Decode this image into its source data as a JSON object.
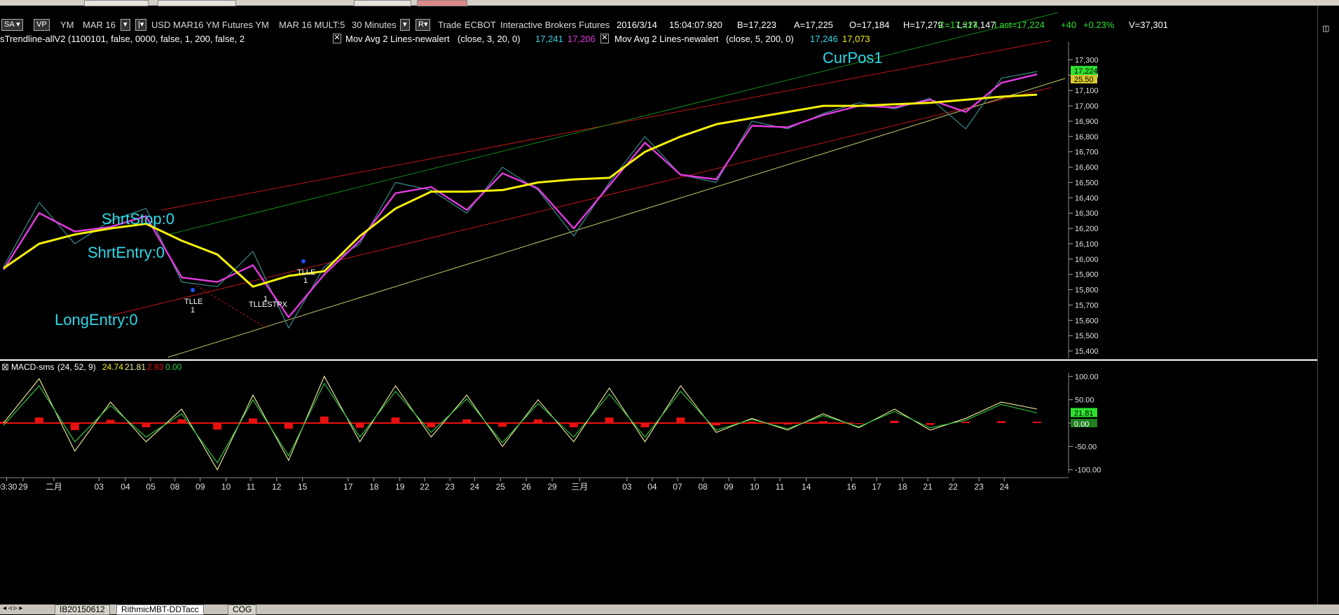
{
  "toolbar": {
    "sa_label": "SA",
    "vp_label": "VP",
    "symbol": "YM",
    "contract": "MAR 16",
    "description": "USD MAR16 YM Futures YM",
    "multiplier": "MAR 16 MULT:5",
    "interval": "30 Minutes",
    "r_label": "R",
    "trade_label": "Trade",
    "exchange": "ECBOT",
    "broker": "Interactive Brokers",
    "asset_class": "Futures",
    "datetime": "2016/3/14",
    "time": "15:04:07.920",
    "bid": "B=17,223",
    "ask": "A=17,225",
    "open": "O=17,184",
    "high": "H=17,279",
    "low": "L=17,147",
    "close": "C=17,224",
    "last": "Last=17,224",
    "change": "+40",
    "change_pct": "+0.23%",
    "volume": "V=37,301"
  },
  "studies": {
    "trendline": "sTrendline-allV2 (1100101, false, 0000, false, 1, 200, false, 2",
    "ma1_name": "Mov Avg 2 Lines-newalert",
    "ma1_params": "(close, 3, 20, 0)",
    "ma1_v1": "17,241",
    "ma1_v2": "17,206",
    "ma2_name": "Mov Avg 2 Lines-newalert",
    "ma2_params": "(close, 5, 200, 0)",
    "ma2_v1": "17,246",
    "ma2_v2": "17,073"
  },
  "colors": {
    "price": "#3a8a8a",
    "fast_ma": "#e23be0",
    "slow_ma": "#f5f00a",
    "macd_line": "#f5f0a0",
    "signal_line": "#30d040",
    "histogram": "#e81010",
    "channel_red": "#c01818",
    "channel_green": "#1a8a1a",
    "channel_yellow": "#c8c870",
    "cyan_text": "#2fd8e8",
    "axis_text": "#e0e0e0"
  },
  "chart_data": [
    {
      "type": "line",
      "title": "",
      "x_labels": [
        "03:30",
        "29",
        "二月",
        "03",
        "04",
        "05",
        "08",
        "09",
        "10",
        "11",
        "12",
        "15",
        "17",
        "18",
        "19",
        "22",
        "23",
        "24",
        "25",
        "26",
        "29",
        "三月",
        "03",
        "04",
        "07",
        "08",
        "09",
        "10",
        "11",
        "14",
        "16",
        "17",
        "18",
        "21",
        "22",
        "23",
        "24"
      ],
      "y_ticks": [
        15400,
        15500,
        15600,
        15700,
        15800,
        15900,
        16000,
        16100,
        16200,
        16300,
        16400,
        16500,
        16600,
        16700,
        16800,
        16900,
        17000,
        17100,
        17200,
        17300
      ],
      "y_tick_labels": [
        "15,400",
        "15,500",
        "15,600",
        "15,700",
        "15,800",
        "15,900",
        "16,000",
        "16,100",
        "16,200",
        "16,300",
        "16,400",
        "16,500",
        "16,600",
        "16,700",
        "16,800",
        "16,900",
        "17,000",
        "17,100",
        "17,200",
        "17,300"
      ],
      "ylim": [
        15350,
        17380
      ],
      "series": [
        {
          "name": "Price",
          "x": [
            0,
            1,
            2,
            3,
            4,
            5,
            6,
            7,
            8,
            9,
            10,
            11,
            12,
            13,
            14,
            15,
            16,
            17,
            18,
            19,
            20,
            21,
            22,
            23,
            24,
            25,
            26,
            27,
            28,
            29
          ],
          "values": [
            15950,
            16370,
            16100,
            16250,
            16330,
            15850,
            15820,
            16050,
            15550,
            15950,
            16100,
            16500,
            16450,
            16300,
            16600,
            16450,
            16150,
            16500,
            16800,
            16550,
            16500,
            16900,
            16850,
            16950,
            17020,
            16980,
            17050,
            16850,
            17180,
            17224
          ]
        },
        {
          "name": "Fast MA",
          "x": [
            0,
            1,
            2,
            3,
            4,
            5,
            6,
            7,
            8,
            9,
            10,
            11,
            12,
            13,
            14,
            15,
            16,
            17,
            18,
            19,
            20,
            21,
            22,
            23,
            24,
            25,
            26,
            27,
            28,
            29
          ],
          "values": [
            15930,
            16300,
            16180,
            16210,
            16280,
            15880,
            15850,
            15960,
            15620,
            15900,
            16120,
            16430,
            16470,
            16320,
            16560,
            16460,
            16200,
            16480,
            16760,
            16550,
            16520,
            16870,
            16860,
            16940,
            17000,
            16990,
            17040,
            16960,
            17150,
            17206
          ]
        },
        {
          "name": "Slow MA",
          "x": [
            0,
            1,
            2,
            3,
            4,
            5,
            6,
            7,
            8,
            9,
            10,
            11,
            12,
            13,
            14,
            15,
            16,
            17,
            18,
            19,
            20,
            21,
            22,
            23,
            24,
            25,
            26,
            27,
            28,
            29
          ],
          "values": [
            15940,
            16100,
            16160,
            16200,
            16230,
            16120,
            16030,
            15820,
            15890,
            15920,
            16150,
            16330,
            16440,
            16440,
            16450,
            16500,
            16520,
            16530,
            16700,
            16800,
            16880,
            16920,
            16960,
            17000,
            17000,
            17010,
            17020,
            17040,
            17060,
            17073
          ]
        }
      ],
      "annotations": [
        "ShrtStop:0",
        "ShrtEntry:0",
        "LongEntry:0",
        "CurPos1",
        "TLLE",
        "1",
        "TLLE",
        "1",
        "TLLESTPX",
        "1",
        "TLLE",
        "1"
      ],
      "last_value_tags": [
        "17,224",
        "25.50"
      ],
      "grid": false
    },
    {
      "type": "line",
      "title": "MACD-sms",
      "params": "(24, 52, 9)",
      "macd_value": "24.74",
      "signal_value": "21.81",
      "hist_value": "2.93",
      "zero_value": "0.00",
      "y_ticks": [
        100,
        50,
        0,
        -50,
        -100
      ],
      "y_tick_labels": [
        "100.00",
        "50.00",
        "",
        "-50.00",
        "-100.00"
      ],
      "ylim": [
        -108,
        108
      ],
      "last_value_tags": [
        "21.81",
        "0.00"
      ],
      "series": [
        {
          "name": "MACD",
          "x": [
            0,
            1,
            2,
            3,
            4,
            5,
            6,
            7,
            8,
            9,
            10,
            11,
            12,
            13,
            14,
            15,
            16,
            17,
            18,
            19,
            20,
            21,
            22,
            23,
            24,
            25,
            26,
            27,
            28,
            29
          ],
          "values": [
            0,
            95,
            -60,
            45,
            -40,
            30,
            -100,
            60,
            -80,
            100,
            -40,
            80,
            -30,
            60,
            -50,
            50,
            -40,
            75,
            -40,
            80,
            -20,
            10,
            -15,
            20,
            -10,
            30,
            -15,
            10,
            45,
            30
          ]
        },
        {
          "name": "Signal",
          "x": [
            0,
            1,
            2,
            3,
            4,
            5,
            6,
            7,
            8,
            9,
            10,
            11,
            12,
            13,
            14,
            15,
            16,
            17,
            18,
            19,
            20,
            21,
            22,
            23,
            24,
            25,
            26,
            27,
            28,
            29
          ],
          "values": [
            -5,
            80,
            -40,
            38,
            -30,
            20,
            -85,
            50,
            -70,
            85,
            -30,
            68,
            -20,
            52,
            -42,
            42,
            -30,
            62,
            -30,
            68,
            -15,
            8,
            -12,
            16,
            -8,
            25,
            -10,
            6,
            40,
            21.81
          ]
        },
        {
          "name": "Histogram",
          "x": [
            0,
            1,
            2,
            3,
            4,
            5,
            6,
            7,
            8,
            9,
            10,
            11,
            12,
            13,
            14,
            15,
            16,
            17,
            18,
            19,
            20,
            21,
            22,
            23,
            24,
            25,
            26,
            27,
            28,
            29
          ],
          "values": [
            3,
            12,
            -15,
            7,
            -9,
            8,
            -14,
            10,
            -12,
            14,
            -10,
            12,
            -9,
            8,
            -8,
            8,
            -9,
            12,
            -9,
            12,
            -5,
            3,
            -3,
            4,
            -2,
            5,
            -4,
            3,
            4,
            2.93
          ]
        }
      ]
    }
  ],
  "tabs": {
    "t1": "IB20150612",
    "t2": "RithmicMBT-DDTacc",
    "t3": "COG"
  }
}
